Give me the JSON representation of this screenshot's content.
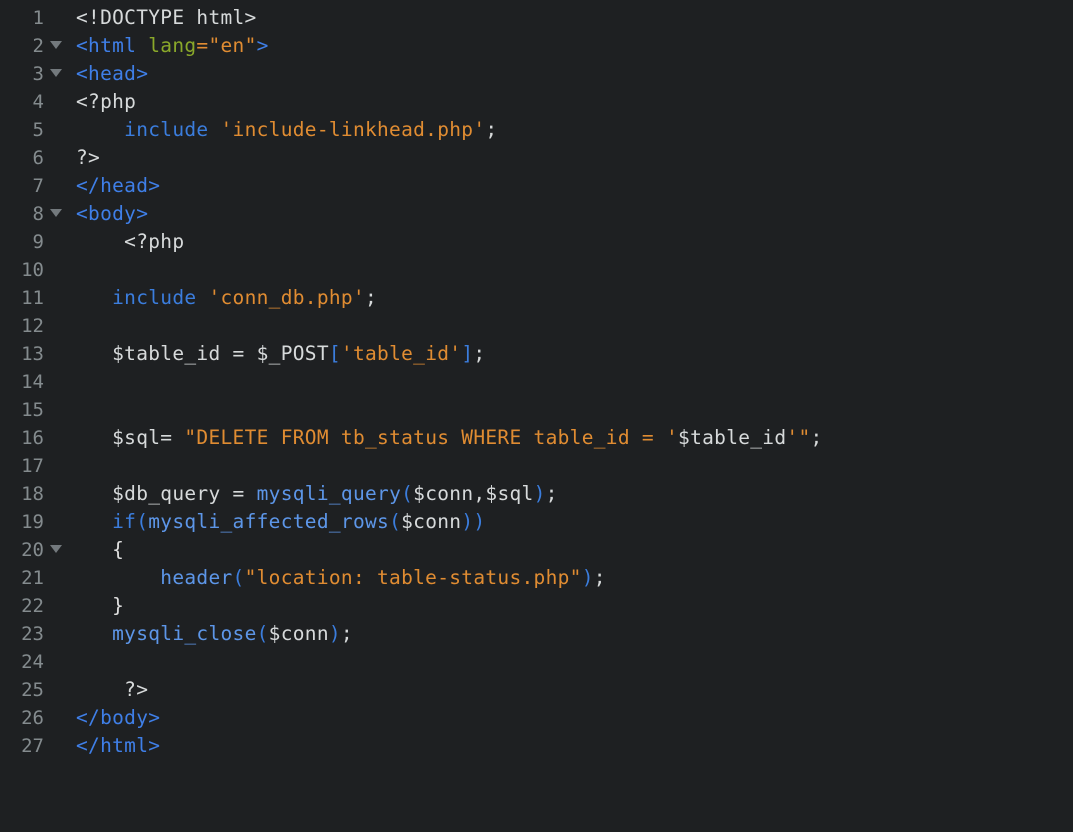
{
  "editor": {
    "name": "code-editor",
    "language": "php",
    "background_color": "#1e2022",
    "gutter_color": "#848b8e",
    "total_lines": 27,
    "colors": {
      "plain": "#d7dadb",
      "tag": "#3f7fe8",
      "attribute": "#8aa82a",
      "string": "#e08c32",
      "keyword": "#3b7ddd",
      "function": "#5d96e8",
      "punctuation": "#3b7ddd",
      "brace": "#e0e0e0"
    }
  },
  "lines": [
    {
      "number": "1",
      "fold": false,
      "indent": 0,
      "tokens": [
        {
          "text": "<!DOCTYPE html>",
          "type": "plain"
        }
      ]
    },
    {
      "number": "2",
      "fold": true,
      "indent": 0,
      "tokens": [
        {
          "text": "<html ",
          "type": "tag"
        },
        {
          "text": "lang",
          "type": "attr"
        },
        {
          "text": "=",
          "type": "string"
        },
        {
          "text": "\"en\"",
          "type": "string"
        },
        {
          "text": ">",
          "type": "tag"
        }
      ]
    },
    {
      "number": "3",
      "fold": true,
      "indent": 0,
      "tokens": [
        {
          "text": "<head>",
          "type": "tag"
        }
      ]
    },
    {
      "number": "4",
      "fold": false,
      "indent": 0,
      "tokens": [
        {
          "text": "<?php",
          "type": "plain"
        }
      ]
    },
    {
      "number": "5",
      "fold": false,
      "indent": 0,
      "tokens": [
        {
          "text": "    ",
          "type": "plain"
        },
        {
          "text": "include",
          "type": "kw"
        },
        {
          "text": " ",
          "type": "plain"
        },
        {
          "text": "'include-linkhead.php'",
          "type": "string"
        },
        {
          "text": ";",
          "type": "semi"
        }
      ]
    },
    {
      "number": "6",
      "fold": false,
      "indent": 0,
      "tokens": [
        {
          "text": "?>",
          "type": "plain"
        }
      ]
    },
    {
      "number": "7",
      "fold": false,
      "indent": 0,
      "tokens": [
        {
          "text": "</head>",
          "type": "tag"
        }
      ]
    },
    {
      "number": "8",
      "fold": true,
      "indent": 0,
      "tokens": [
        {
          "text": "<body>",
          "type": "tag"
        }
      ]
    },
    {
      "number": "9",
      "fold": false,
      "indent": 0,
      "tokens": [
        {
          "text": "    ",
          "type": "plain"
        },
        {
          "text": "<?php",
          "type": "plain"
        }
      ]
    },
    {
      "number": "10",
      "fold": false,
      "indent": 0,
      "tokens": []
    },
    {
      "number": "11",
      "fold": false,
      "indent": 0,
      "tokens": [
        {
          "text": "   ",
          "type": "plain"
        },
        {
          "text": "include",
          "type": "kw"
        },
        {
          "text": " ",
          "type": "plain"
        },
        {
          "text": "'conn_db.php'",
          "type": "string"
        },
        {
          "text": ";",
          "type": "semi"
        }
      ]
    },
    {
      "number": "12",
      "fold": false,
      "indent": 0,
      "tokens": []
    },
    {
      "number": "13",
      "fold": false,
      "indent": 0,
      "tokens": [
        {
          "text": "   ",
          "type": "plain"
        },
        {
          "text": "$table_id ",
          "type": "var"
        },
        {
          "text": "= ",
          "type": "plain"
        },
        {
          "text": "$_POST",
          "type": "var"
        },
        {
          "text": "[",
          "type": "punct"
        },
        {
          "text": "'table_id'",
          "type": "string"
        },
        {
          "text": "]",
          "type": "punct"
        },
        {
          "text": ";",
          "type": "semi"
        }
      ]
    },
    {
      "number": "14",
      "fold": false,
      "indent": 0,
      "tokens": []
    },
    {
      "number": "15",
      "fold": false,
      "indent": 0,
      "tokens": []
    },
    {
      "number": "16",
      "fold": false,
      "indent": 0,
      "tokens": [
        {
          "text": "   ",
          "type": "plain"
        },
        {
          "text": "$sql",
          "type": "var"
        },
        {
          "text": "= ",
          "type": "plain"
        },
        {
          "text": "\"DELETE FROM tb_status WHERE table_id = '",
          "type": "string"
        },
        {
          "text": "$table_id",
          "type": "var"
        },
        {
          "text": "'\"",
          "type": "string"
        },
        {
          "text": ";",
          "type": "semi"
        }
      ]
    },
    {
      "number": "17",
      "fold": false,
      "indent": 0,
      "tokens": []
    },
    {
      "number": "18",
      "fold": false,
      "indent": 0,
      "tokens": [
        {
          "text": "   ",
          "type": "plain"
        },
        {
          "text": "$db_query ",
          "type": "var"
        },
        {
          "text": "= ",
          "type": "plain"
        },
        {
          "text": "mysqli_query",
          "type": "func"
        },
        {
          "text": "(",
          "type": "punct"
        },
        {
          "text": "$conn",
          "type": "var"
        },
        {
          "text": ",",
          "type": "plain"
        },
        {
          "text": "$sql",
          "type": "var"
        },
        {
          "text": ")",
          "type": "punct"
        },
        {
          "text": ";",
          "type": "semi"
        }
      ]
    },
    {
      "number": "19",
      "fold": false,
      "indent": 0,
      "tokens": [
        {
          "text": "   ",
          "type": "plain"
        },
        {
          "text": "if",
          "type": "kw"
        },
        {
          "text": "(",
          "type": "punct"
        },
        {
          "text": "mysqli_affected_rows",
          "type": "func"
        },
        {
          "text": "(",
          "type": "punct"
        },
        {
          "text": "$conn",
          "type": "var"
        },
        {
          "text": "))",
          "type": "punct"
        }
      ]
    },
    {
      "number": "20",
      "fold": true,
      "indent": 0,
      "tokens": [
        {
          "text": "   ",
          "type": "plain"
        },
        {
          "text": "{",
          "type": "brace"
        }
      ]
    },
    {
      "number": "21",
      "fold": false,
      "indent": 0,
      "tokens": [
        {
          "text": "       ",
          "type": "plain"
        },
        {
          "text": "header",
          "type": "func"
        },
        {
          "text": "(",
          "type": "punct"
        },
        {
          "text": "\"location: table-status.php\"",
          "type": "string"
        },
        {
          "text": ")",
          "type": "punct"
        },
        {
          "text": ";",
          "type": "semi"
        }
      ]
    },
    {
      "number": "22",
      "fold": false,
      "indent": 0,
      "tokens": [
        {
          "text": "   ",
          "type": "plain"
        },
        {
          "text": "}",
          "type": "brace"
        }
      ]
    },
    {
      "number": "23",
      "fold": false,
      "indent": 0,
      "tokens": [
        {
          "text": "   ",
          "type": "plain"
        },
        {
          "text": "mysqli_close",
          "type": "func"
        },
        {
          "text": "(",
          "type": "punct"
        },
        {
          "text": "$conn",
          "type": "var"
        },
        {
          "text": ")",
          "type": "punct"
        },
        {
          "text": ";",
          "type": "semi"
        }
      ]
    },
    {
      "number": "24",
      "fold": false,
      "indent": 0,
      "tokens": []
    },
    {
      "number": "25",
      "fold": false,
      "indent": 0,
      "tokens": [
        {
          "text": "    ",
          "type": "plain"
        },
        {
          "text": "?>",
          "type": "plain"
        }
      ]
    },
    {
      "number": "26",
      "fold": false,
      "indent": 0,
      "tokens": [
        {
          "text": "</body>",
          "type": "tag"
        }
      ]
    },
    {
      "number": "27",
      "fold": false,
      "indent": 0,
      "tokens": [
        {
          "text": "</html>",
          "type": "tag"
        }
      ]
    }
  ]
}
